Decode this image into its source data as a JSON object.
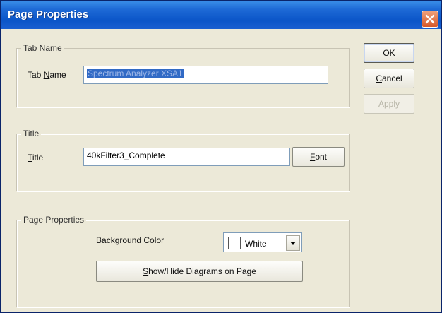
{
  "window": {
    "title": "Page Properties"
  },
  "buttons": {
    "ok": "OK",
    "ok_mnemonic": "O",
    "cancel": "Cancel",
    "cancel_mnemonic": "C",
    "apply": "Apply"
  },
  "tab_name_group": {
    "label": "Tab Name",
    "field_label_pre": "Tab ",
    "field_label_mnemonic": "N",
    "field_label_post": "ame",
    "value": "Spectrum Analyzer XSA1"
  },
  "title_group": {
    "label": "Title",
    "field_label_mnemonic": "T",
    "field_label_post": "itle",
    "value": "40kFilter3_Complete",
    "font_button_mnemonic": "F",
    "font_button_post": "ont"
  },
  "page_props_group": {
    "label": "Page Properties",
    "bg_label_mnemonic": "B",
    "bg_label_post": "ackground Color",
    "bg_value": "White",
    "bg_color": "#ffffff",
    "diagrams_button_mnemonic": "S",
    "diagrams_button_post": "how/Hide Diagrams on Page"
  }
}
